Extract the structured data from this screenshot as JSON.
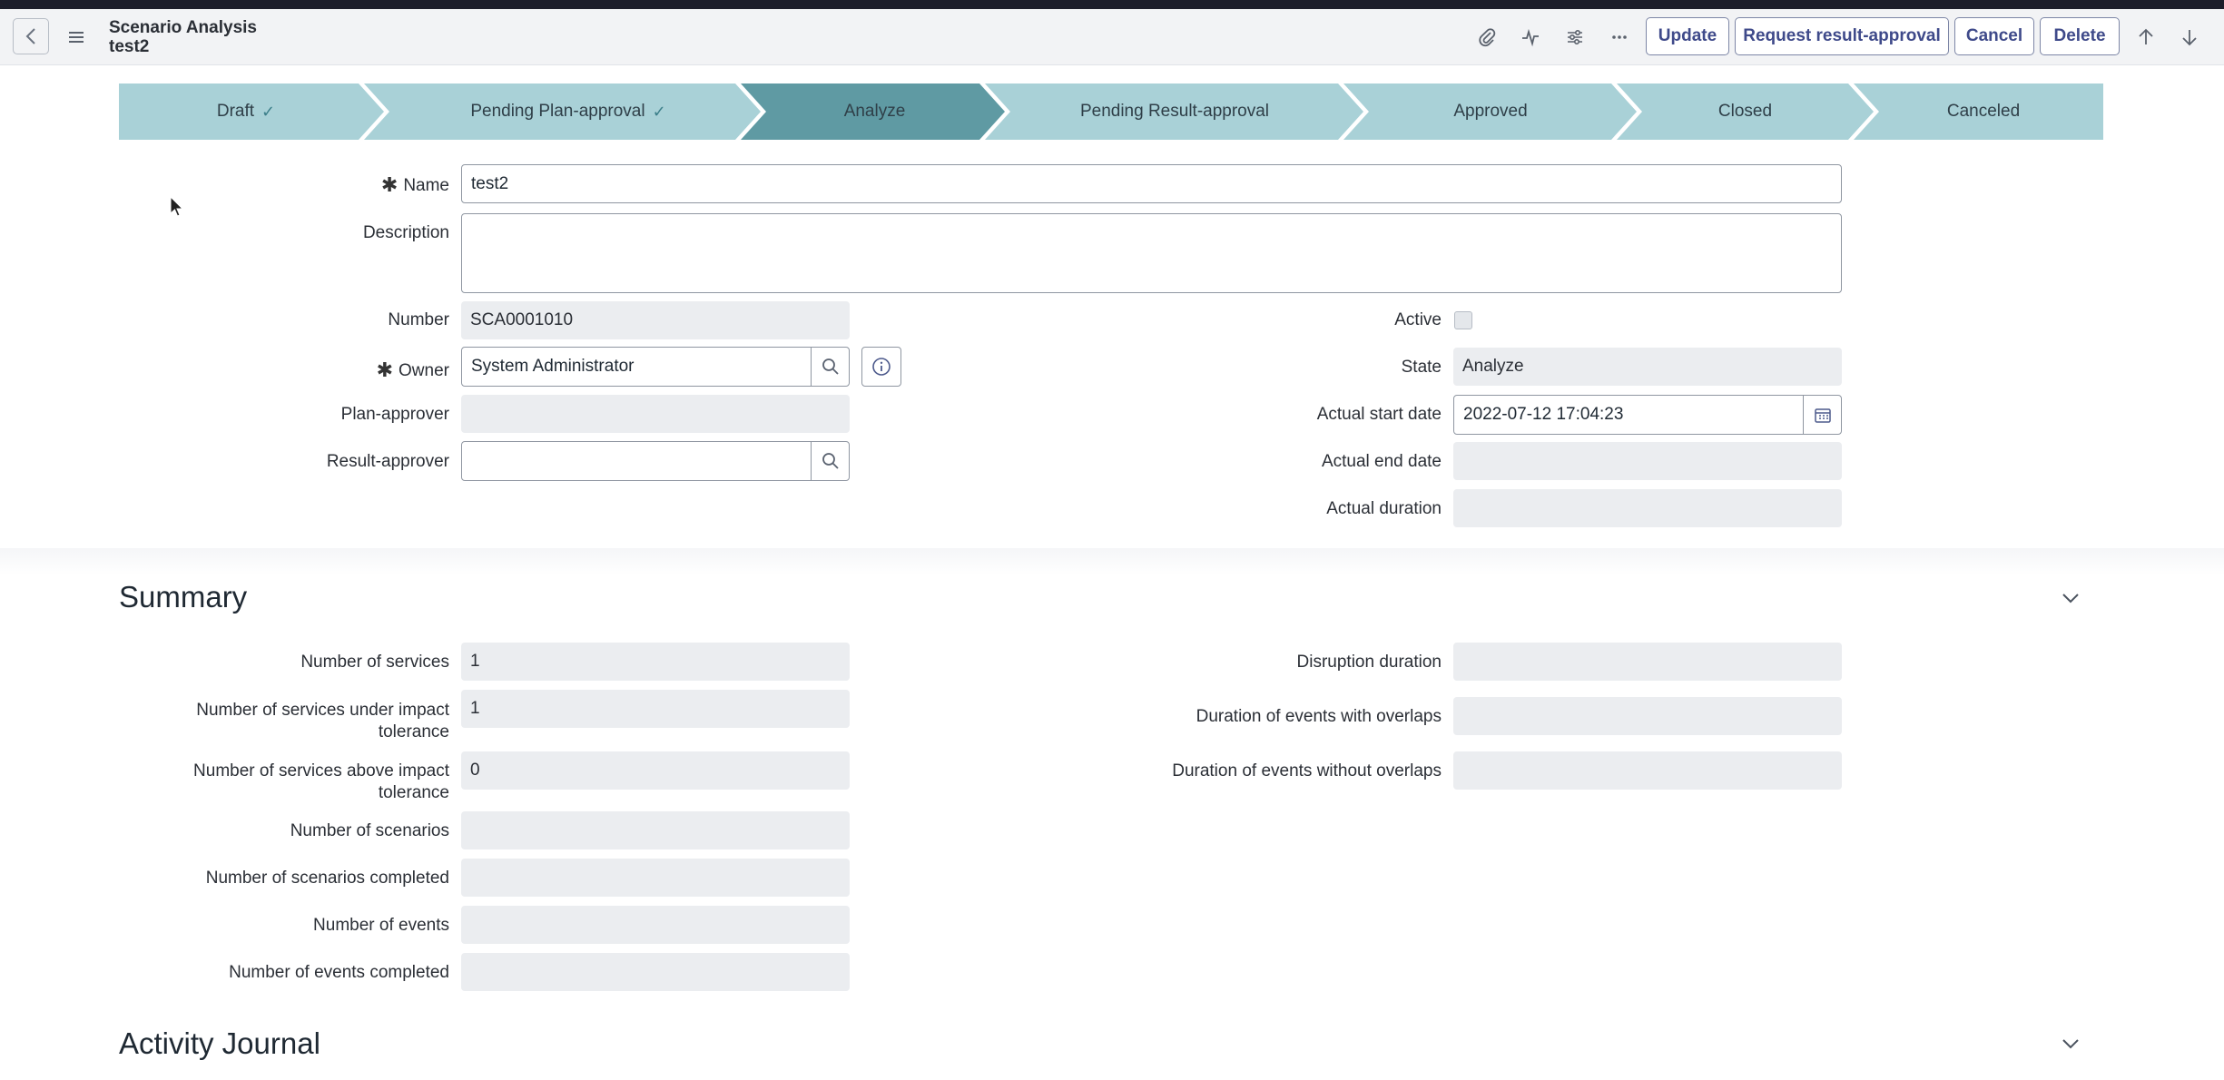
{
  "header": {
    "title": "Scenario Analysis",
    "subtitle": "test2",
    "buttons": {
      "update": "Update",
      "request_result_approval": "Request result-approval",
      "cancel": "Cancel",
      "delete": "Delete"
    }
  },
  "stages": [
    {
      "label": "Draft",
      "done": true
    },
    {
      "label": "Pending Plan-approval",
      "done": true
    },
    {
      "label": "Analyze",
      "current": true
    },
    {
      "label": "Pending Result-approval"
    },
    {
      "label": "Approved"
    },
    {
      "label": "Closed"
    },
    {
      "label": "Canceled"
    }
  ],
  "form": {
    "required_mark": "✱",
    "name": {
      "label": "Name",
      "value": "test2"
    },
    "description": {
      "label": "Description",
      "value": ""
    },
    "number": {
      "label": "Number",
      "value": "SCA0001010"
    },
    "owner": {
      "label": "Owner",
      "value": "System Administrator"
    },
    "plan_approver": {
      "label": "Plan-approver",
      "value": ""
    },
    "result_approver": {
      "label": "Result-approver",
      "value": ""
    },
    "active": {
      "label": "Active",
      "checked": false
    },
    "state": {
      "label": "State",
      "value": "Analyze"
    },
    "actual_start_date": {
      "label": "Actual start date",
      "value": "2022-07-12 17:04:23"
    },
    "actual_end_date": {
      "label": "Actual end date",
      "value": ""
    },
    "actual_duration": {
      "label": "Actual duration",
      "value": ""
    }
  },
  "summary": {
    "title": "Summary",
    "number_of_services": {
      "label": "Number of services",
      "value": "1"
    },
    "services_under_tolerance": {
      "label_line1": "Number of services under impact",
      "label_line2": "tolerance",
      "value": "1"
    },
    "services_above_tolerance": {
      "label_line1": "Number of services above impact",
      "label_line2": "tolerance",
      "value": "0"
    },
    "number_of_scenarios": {
      "label": "Number of scenarios",
      "value": ""
    },
    "scenarios_completed": {
      "label": "Number of scenarios completed",
      "value": ""
    },
    "number_of_events": {
      "label": "Number of events",
      "value": ""
    },
    "events_completed": {
      "label": "Number of events completed",
      "value": ""
    },
    "disruption_duration": {
      "label": "Disruption duration",
      "value": ""
    },
    "duration_with_overlaps": {
      "label": "Duration of events with overlaps",
      "value": ""
    },
    "duration_without_overlaps": {
      "label": "Duration of events without overlaps",
      "value": ""
    }
  },
  "activity_journal": {
    "title": "Activity Journal"
  },
  "colors": {
    "stage_bg": "#a8d0d6",
    "stage_current": "#5f9aa3",
    "field_readonly": "#ebedf0",
    "button_text": "#3f4a8a"
  }
}
